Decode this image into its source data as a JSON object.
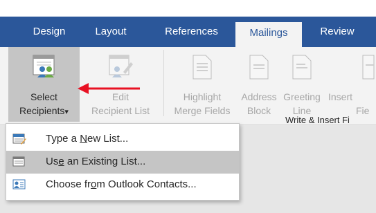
{
  "tabs": [
    "Design",
    "Layout",
    "References",
    "Mailings",
    "Review"
  ],
  "ribbon": {
    "select_recipients": {
      "line1": "Select",
      "line2": "Recipients",
      "dropdown": "▾"
    },
    "edit_recipient_list": {
      "line1": "Edit",
      "line2": "Recipient List"
    },
    "highlight_merge_fields": {
      "line1": "Highlight",
      "line2": "Merge Fields"
    },
    "address_block": {
      "line1": "Address",
      "line2": "Block"
    },
    "greeting_line": {
      "line1": "Greeting",
      "line2": "Line"
    },
    "insert_merge_field": {
      "line1": "Insert",
      "line2": "Fie"
    },
    "group_label": "Write & Insert Fi"
  },
  "menu": {
    "items": [
      {
        "before": "Type a ",
        "key": "N",
        "after": "ew List..."
      },
      {
        "before": "Us",
        "key": "e",
        "after": " an Existing List..."
      },
      {
        "before": "Choose fr",
        "key": "o",
        "after": "m Outlook Contacts..."
      }
    ]
  },
  "colors": {
    "tab_bar": "#2b579a",
    "ribbon": "#f3f3f3",
    "selected": "#c5c5c5",
    "arrow": "#e81123"
  }
}
